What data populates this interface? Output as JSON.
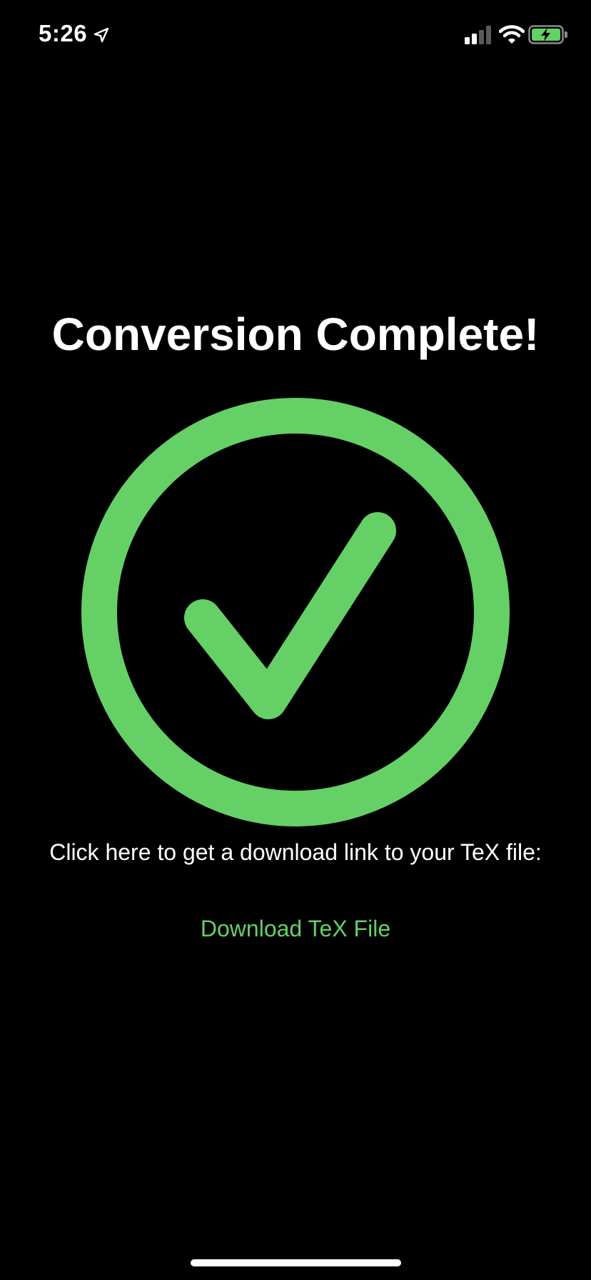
{
  "status_bar": {
    "time": "5:26",
    "location_icon": "location-arrow-icon",
    "signal_icon": "cellular-signal-icon",
    "wifi_icon": "wifi-icon",
    "battery_icon": "battery-charging-icon"
  },
  "main": {
    "title": "Conversion Complete!",
    "status_icon": "checkmark-circle-icon",
    "prompt": "Click here to get a download link to your TeX file:",
    "download_label": "Download TeX File"
  },
  "colors": {
    "background": "#000000",
    "accent_green": "#65d066",
    "text": "#ffffff"
  }
}
